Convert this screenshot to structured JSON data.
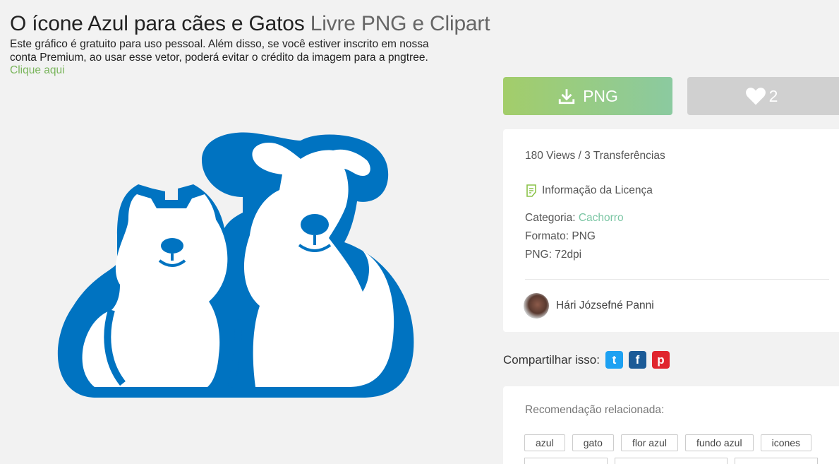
{
  "page": {
    "title_main": "O ícone Azul para cães e Gatos",
    "title_sub": "Livre PNG e Clipart",
    "description": "Este gráfico é gratuito para uso pessoal. Além disso, se você estiver inscrito em nossa conta Premium, ao usar esse vetor, poderá evitar o crédito da imagem para a pngtree.",
    "description_link": "Clique aqui"
  },
  "actions": {
    "download_label": "PNG",
    "like_count": "2"
  },
  "info": {
    "stats": "180 Views / 3 Transferências",
    "license_label": "Informação da Licença",
    "category_label": "Categoria:",
    "category_value": "Cachorro",
    "format": "Formato: PNG",
    "resolution": "PNG: 72dpi",
    "author": "Hári Józsefné Panni"
  },
  "share": {
    "label": "Compartilhar isso:",
    "twitter": "t",
    "facebook": "f",
    "pinterest": "p"
  },
  "recommend": {
    "label": "Recomendação relacionada:",
    "tags": [
      "azul",
      "gato",
      "flor azul",
      "fundo azul",
      "icones"
    ]
  },
  "colors": {
    "accent_green": "#7ab55c",
    "logo_blue": "#0073c1"
  },
  "icons": [
    "download-icon",
    "heart-icon",
    "license-icon",
    "twitter-icon",
    "facebook-icon",
    "pinterest-icon"
  ]
}
